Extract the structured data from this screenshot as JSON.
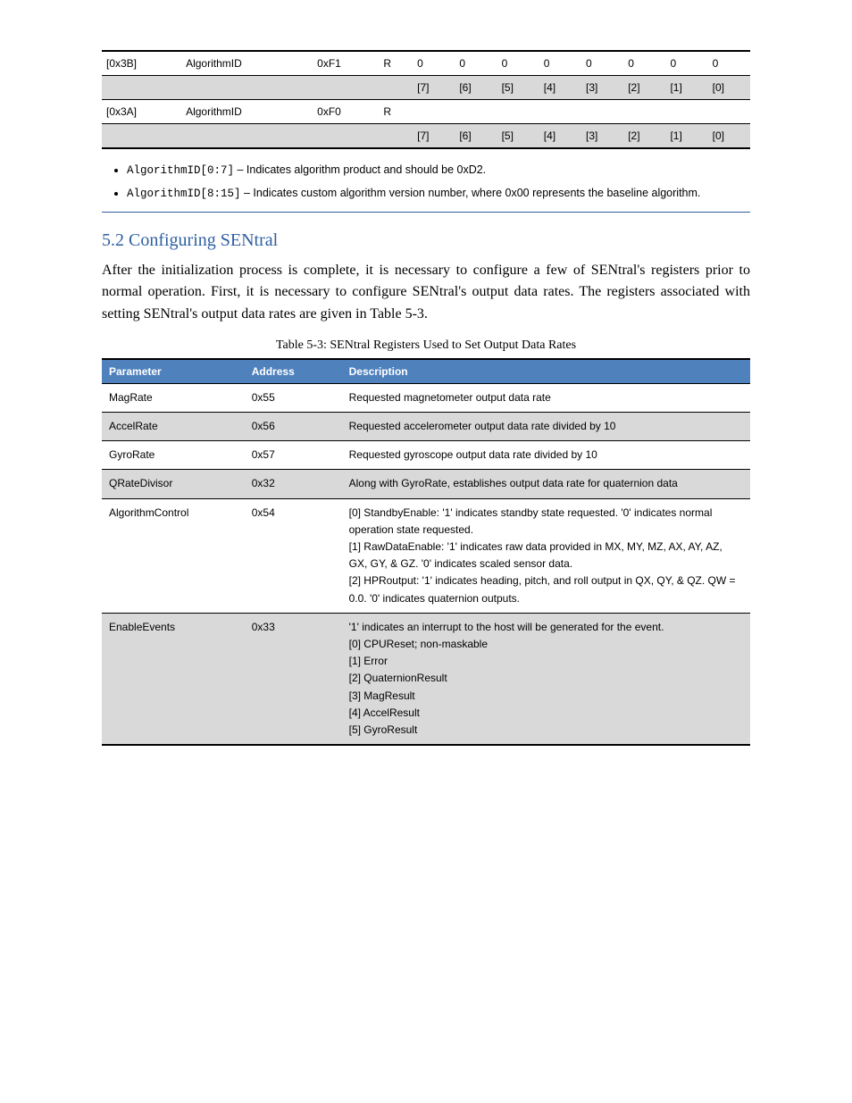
{
  "table1": {
    "rows": [
      [
        "[0x3B]",
        "AlgorithmID",
        "0xF1",
        "R",
        "0",
        "0",
        "0",
        "0",
        "0",
        "0",
        "0",
        "0"
      ],
      [
        "",
        "",
        "",
        "",
        "[7]",
        "[6]",
        "[5]",
        "[4]",
        "[3]",
        "[2]",
        "[1]",
        "[0]"
      ],
      [
        "[0x3A]",
        "AlgorithmID",
        "0xF0",
        "R",
        "",
        "",
        "",
        "",
        "",
        "",
        "",
        ""
      ],
      [
        "",
        "",
        "",
        "",
        "[7]",
        "[6]",
        "[5]",
        "[4]",
        "[3]",
        "[2]",
        "[1]",
        "[0]"
      ]
    ]
  },
  "legend": {
    "item1_prefix": "AlgorithmID[0:7]",
    "item1_text": " – Indicates algorithm product and should be 0xD2.",
    "item2_prefix": "AlgorithmID[8:15]",
    "item2_text": " – Indicates custom algorithm version number, where 0x00 represents the baseline algorithm."
  },
  "section": {
    "heading": "5.2  Configuring SENtral",
    "para": "After the initialization process is complete, it is necessary to configure a few of SENtral's registers prior to normal operation. First, it is necessary to configure SENtral's output data rates. The registers associated with setting SENtral's output data rates are given in Table 5-3."
  },
  "table2": {
    "caption": "Table 5-3: SENtral Registers Used to Set Output Data Rates",
    "headers": [
      "Parameter",
      "Address",
      "Description"
    ],
    "rows": [
      {
        "p": "MagRate",
        "a": "0x55",
        "d": "Requested magnetometer output data rate"
      },
      {
        "p": "AccelRate",
        "a": "0x56",
        "d": "Requested accelerometer output data rate divided by 10"
      },
      {
        "p": "GyroRate",
        "a": "0x57",
        "d": "Requested gyroscope output data rate divided by 10"
      },
      {
        "p": "QRateDivisor",
        "a": "0x32",
        "d": "Along with GyroRate, establishes output data rate for quaternion data"
      },
      {
        "p": "AlgorithmControl",
        "a": "0x54",
        "d_full": "[0] StandbyEnable: '1' indicates standby state requested. '0' indicates normal operation state requested.\n[1] RawDataEnable: '1' indicates raw data provided in MX, MY, MZ, AX, AY, AZ, GX, GY, & GZ. '0' indicates scaled sensor data.\n[2] HPRoutput: '1' indicates heading, pitch, and roll output in QX, QY, & QZ. QW = 0.0. '0' indicates quaternion outputs."
      },
      {
        "p": "EnableEvents",
        "a": "0x33",
        "d_full": "'1' indicates an interrupt to the host will be generated for the event.\n[0] CPUReset; non-maskable\n[1] Error\n[2] QuaternionResult\n[3] MagResult\n[4] AccelResult\n[5] GyroResult"
      }
    ]
  }
}
